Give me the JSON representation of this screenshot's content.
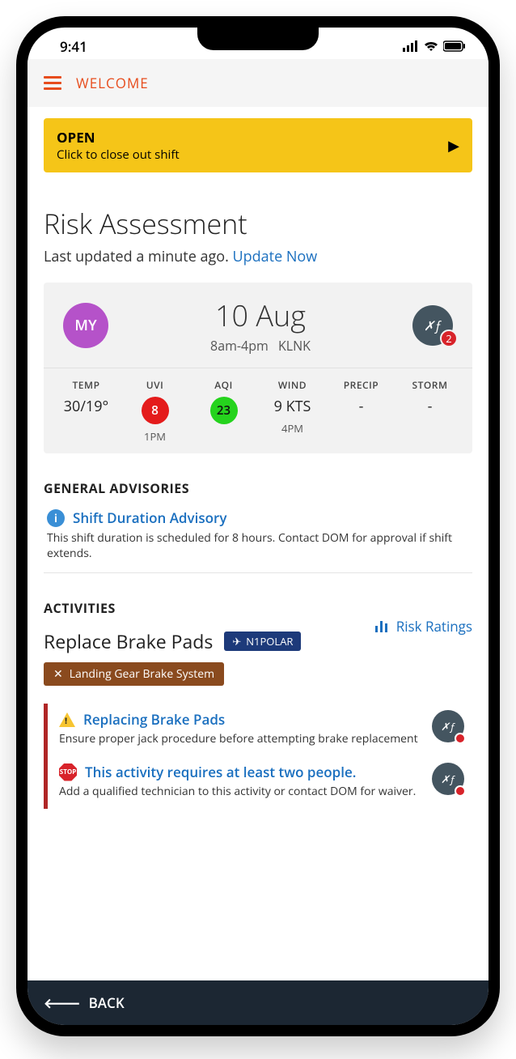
{
  "status_bar": {
    "time": "9:41"
  },
  "header": {
    "title": "WELCOME"
  },
  "banner": {
    "title": "OPEN",
    "subtitle": "Click to close out shift"
  },
  "page": {
    "title": "Risk Assessment",
    "updated_prefix": "Last updated a minute ago. ",
    "update_link": "Update Now"
  },
  "shift": {
    "avatar_initials": "MY",
    "date": "10 Aug",
    "time_range": "8am-4pm",
    "location": "KLNK",
    "sign_count": "2"
  },
  "metrics": {
    "temp": {
      "label": "TEMP",
      "value": "30/19°",
      "time": ""
    },
    "uvi": {
      "label": "UVI",
      "value": "8",
      "time": "1PM"
    },
    "aqi": {
      "label": "AQI",
      "value": "23",
      "time": ""
    },
    "wind": {
      "label": "WIND",
      "value": "9 KTS",
      "time": "4PM"
    },
    "precip": {
      "label": "PRECIP",
      "value": "-",
      "time": ""
    },
    "storm": {
      "label": "STORM",
      "value": "-",
      "time": ""
    }
  },
  "advisories": {
    "heading": "GENERAL ADVISORIES",
    "items": [
      {
        "title": "Shift Duration Advisory",
        "body": "This shift duration is scheduled for 8 hours. Contact DOM for approval if shift extends."
      }
    ]
  },
  "activities": {
    "heading": "ACTIVITIES",
    "name": "Replace Brake Pads",
    "tail": "N1POLAR",
    "system_tag": "Landing Gear Brake System",
    "risk_link": "Risk Ratings",
    "alerts": [
      {
        "icon": "warn",
        "title": "Replacing Brake Pads",
        "body": "Ensure proper jack procedure before attempting brake replacement"
      },
      {
        "icon": "stop",
        "title": "This activity requires at least two people.",
        "body": "Add a qualified technician to this activity or contact DOM for waiver."
      }
    ]
  },
  "footer": {
    "back": "BACK"
  }
}
